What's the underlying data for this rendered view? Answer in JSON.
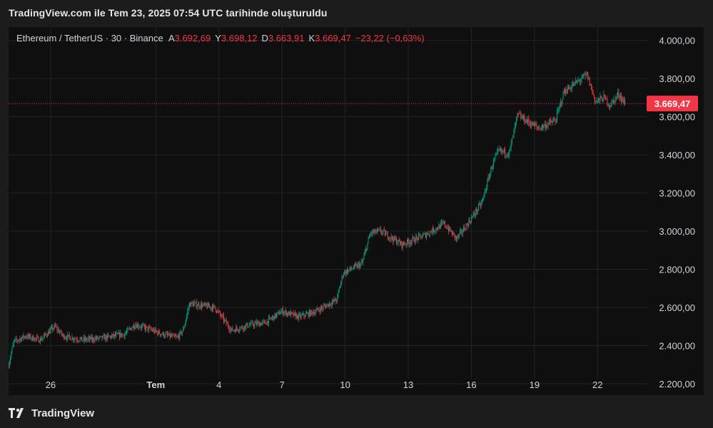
{
  "caption": "TradingView.com ile Tem 23, 2025 07:54 UTC tarihinde oluşturuldu",
  "legend": {
    "symbol": "Ethereum / TetherUS · 30 · Binance",
    "open_label": "A",
    "open": "3.692,69",
    "high_label": "Y",
    "high": "3.698,12",
    "low_label": "D",
    "low": "3.663,91",
    "close_label": "K",
    "close": "3.669,47",
    "change": "−23,22 (−0,63%)"
  },
  "footer": {
    "brand": "TradingView",
    "logo_icon": "tradingview-logo-icon"
  },
  "colors": {
    "up": "#089981",
    "down": "#f23645",
    "grid": "#232323",
    "background": "#0f0f0f"
  },
  "chart_data": {
    "type": "candlestick",
    "title": "",
    "xlabel": "",
    "ylabel": "",
    "ylim": [
      2140,
      4070
    ],
    "y_ticks": [
      {
        "value": 4000,
        "label": "4.000,00"
      },
      {
        "value": 3800,
        "label": "3.800,00"
      },
      {
        "value": 3600,
        "label": "3.600,00"
      },
      {
        "value": 3400,
        "label": "3.400,00"
      },
      {
        "value": 3200,
        "label": "3.200,00"
      },
      {
        "value": 3000,
        "label": "3.000,00"
      },
      {
        "value": 2800,
        "label": "2.800,00"
      },
      {
        "value": 2600,
        "label": "2.600,00"
      },
      {
        "value": 2400,
        "label": "2.400,00"
      },
      {
        "value": 2200,
        "label": "2.200,00"
      }
    ],
    "x_range_days": [
      0,
      30.4
    ],
    "x_ticks": [
      {
        "day": 2,
        "label": "26",
        "bold": false
      },
      {
        "day": 7,
        "label": "Tem",
        "bold": true
      },
      {
        "day": 10,
        "label": "4",
        "bold": false
      },
      {
        "day": 13,
        "label": "7",
        "bold": false
      },
      {
        "day": 16,
        "label": "10",
        "bold": false
      },
      {
        "day": 19,
        "label": "13",
        "bold": false
      },
      {
        "day": 22,
        "label": "16",
        "bold": false
      },
      {
        "day": 25,
        "label": "19",
        "bold": false
      },
      {
        "day": 28,
        "label": "22",
        "bold": false
      }
    ],
    "last_price": {
      "value": 3669.47,
      "label": "3.669,47"
    },
    "anchors": [
      [
        0.0,
        2300
      ],
      [
        0.25,
        2420
      ],
      [
        0.8,
        2450
      ],
      [
        1.5,
        2430
      ],
      [
        2.2,
        2500
      ],
      [
        2.6,
        2450
      ],
      [
        3.5,
        2430
      ],
      [
        4.5,
        2440
      ],
      [
        5.5,
        2460
      ],
      [
        6.0,
        2510
      ],
      [
        6.6,
        2490
      ],
      [
        7.3,
        2460
      ],
      [
        8.0,
        2440
      ],
      [
        8.3,
        2480
      ],
      [
        8.6,
        2620
      ],
      [
        9.2,
        2610
      ],
      [
        9.8,
        2600
      ],
      [
        10.6,
        2480
      ],
      [
        11.5,
        2510
      ],
      [
        12.2,
        2520
      ],
      [
        13.0,
        2580
      ],
      [
        13.8,
        2550
      ],
      [
        14.6,
        2580
      ],
      [
        15.6,
        2640
      ],
      [
        15.9,
        2780
      ],
      [
        16.8,
        2830
      ],
      [
        17.2,
        2990
      ],
      [
        17.7,
        3000
      ],
      [
        18.7,
        2930
      ],
      [
        19.8,
        2980
      ],
      [
        20.7,
        3040
      ],
      [
        21.3,
        2960
      ],
      [
        21.9,
        3050
      ],
      [
        22.5,
        3150
      ],
      [
        23.0,
        3350
      ],
      [
        23.3,
        3420
      ],
      [
        23.8,
        3410
      ],
      [
        24.2,
        3610
      ],
      [
        24.6,
        3580
      ],
      [
        25.2,
        3540
      ],
      [
        26.0,
        3580
      ],
      [
        26.4,
        3730
      ],
      [
        27.0,
        3780
      ],
      [
        27.5,
        3820
      ],
      [
        27.9,
        3680
      ],
      [
        28.3,
        3700
      ],
      [
        28.6,
        3660
      ],
      [
        29.0,
        3720
      ],
      [
        29.3,
        3669
      ]
    ]
  }
}
